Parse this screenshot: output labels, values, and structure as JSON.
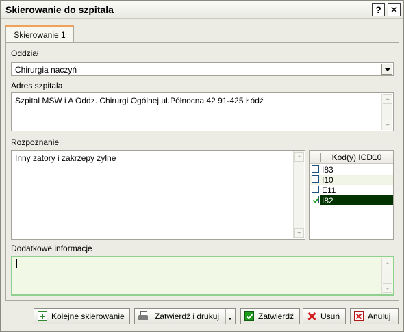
{
  "window": {
    "title": "Skierowanie do szpitala",
    "help_label": "?",
    "close_label": "✕"
  },
  "tabs": [
    {
      "label": "Skierowanie 1",
      "active": true
    }
  ],
  "form": {
    "department_label": "Oddział",
    "department_value": "Chirurgia naczyń",
    "address_label": "Adres szpitala",
    "address_value": "Szpital MSW i A Oddz. Chirurgi Ogólnej ul.Północna 42 91-425 Łódź",
    "diagnosis_label": "Rozpoznanie",
    "diagnosis_value": "Inny zatory i zakrzepy żylne",
    "additional_label": "Dodatkowe informacje",
    "additional_value": ""
  },
  "icd": {
    "header": "Kod(y) ICD10",
    "rows": [
      {
        "code": "I83",
        "checked": false,
        "selected": false
      },
      {
        "code": "I10",
        "checked": false,
        "selected": false
      },
      {
        "code": "E11",
        "checked": false,
        "selected": false
      },
      {
        "code": "I82",
        "checked": true,
        "selected": true
      }
    ]
  },
  "buttons": {
    "next": "Kolejne skierowanie",
    "approve_print": "Zatwierdź i drukuj",
    "approve": "Zatwierdź",
    "delete": "Usuń",
    "cancel": "Anuluj"
  },
  "colors": {
    "selected_row": "#003300",
    "focus_border": "#8fd08f",
    "tab_accent": "#f0a15a"
  },
  "icons": {
    "next": "plus-icon",
    "approve_print": "printer-icon",
    "approve": "check-icon",
    "delete": "x-icon",
    "cancel": "x-box-icon"
  }
}
